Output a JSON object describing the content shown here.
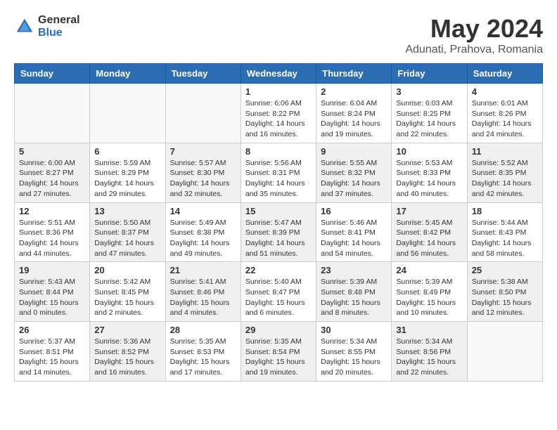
{
  "logo": {
    "general": "General",
    "blue": "Blue"
  },
  "title": {
    "month_year": "May 2024",
    "location": "Adunati, Prahova, Romania"
  },
  "weekdays": [
    "Sunday",
    "Monday",
    "Tuesday",
    "Wednesday",
    "Thursday",
    "Friday",
    "Saturday"
  ],
  "weeks": [
    [
      {
        "day": "",
        "info": "",
        "empty": true
      },
      {
        "day": "",
        "info": "",
        "empty": true
      },
      {
        "day": "",
        "info": "",
        "empty": true
      },
      {
        "day": "1",
        "info": "Sunrise: 6:06 AM\nSunset: 8:22 PM\nDaylight: 14 hours\nand 16 minutes."
      },
      {
        "day": "2",
        "info": "Sunrise: 6:04 AM\nSunset: 8:24 PM\nDaylight: 14 hours\nand 19 minutes."
      },
      {
        "day": "3",
        "info": "Sunrise: 6:03 AM\nSunset: 8:25 PM\nDaylight: 14 hours\nand 22 minutes."
      },
      {
        "day": "4",
        "info": "Sunrise: 6:01 AM\nSunset: 8:26 PM\nDaylight: 14 hours\nand 24 minutes."
      }
    ],
    [
      {
        "day": "5",
        "info": "Sunrise: 6:00 AM\nSunset: 8:27 PM\nDaylight: 14 hours\nand 27 minutes.",
        "shaded": true
      },
      {
        "day": "6",
        "info": "Sunrise: 5:59 AM\nSunset: 8:29 PM\nDaylight: 14 hours\nand 29 minutes."
      },
      {
        "day": "7",
        "info": "Sunrise: 5:57 AM\nSunset: 8:30 PM\nDaylight: 14 hours\nand 32 minutes.",
        "shaded": true
      },
      {
        "day": "8",
        "info": "Sunrise: 5:56 AM\nSunset: 8:31 PM\nDaylight: 14 hours\nand 35 minutes."
      },
      {
        "day": "9",
        "info": "Sunrise: 5:55 AM\nSunset: 8:32 PM\nDaylight: 14 hours\nand 37 minutes.",
        "shaded": true
      },
      {
        "day": "10",
        "info": "Sunrise: 5:53 AM\nSunset: 8:33 PM\nDaylight: 14 hours\nand 40 minutes."
      },
      {
        "day": "11",
        "info": "Sunrise: 5:52 AM\nSunset: 8:35 PM\nDaylight: 14 hours\nand 42 minutes.",
        "shaded": true
      }
    ],
    [
      {
        "day": "12",
        "info": "Sunrise: 5:51 AM\nSunset: 8:36 PM\nDaylight: 14 hours\nand 44 minutes."
      },
      {
        "day": "13",
        "info": "Sunrise: 5:50 AM\nSunset: 8:37 PM\nDaylight: 14 hours\nand 47 minutes.",
        "shaded": true
      },
      {
        "day": "14",
        "info": "Sunrise: 5:49 AM\nSunset: 8:38 PM\nDaylight: 14 hours\nand 49 minutes."
      },
      {
        "day": "15",
        "info": "Sunrise: 5:47 AM\nSunset: 8:39 PM\nDaylight: 14 hours\nand 51 minutes.",
        "shaded": true
      },
      {
        "day": "16",
        "info": "Sunrise: 5:46 AM\nSunset: 8:41 PM\nDaylight: 14 hours\nand 54 minutes."
      },
      {
        "day": "17",
        "info": "Sunrise: 5:45 AM\nSunset: 8:42 PM\nDaylight: 14 hours\nand 56 minutes.",
        "shaded": true
      },
      {
        "day": "18",
        "info": "Sunrise: 5:44 AM\nSunset: 8:43 PM\nDaylight: 14 hours\nand 58 minutes."
      }
    ],
    [
      {
        "day": "19",
        "info": "Sunrise: 5:43 AM\nSunset: 8:44 PM\nDaylight: 15 hours\nand 0 minutes.",
        "shaded": true
      },
      {
        "day": "20",
        "info": "Sunrise: 5:42 AM\nSunset: 8:45 PM\nDaylight: 15 hours\nand 2 minutes."
      },
      {
        "day": "21",
        "info": "Sunrise: 5:41 AM\nSunset: 8:46 PM\nDaylight: 15 hours\nand 4 minutes.",
        "shaded": true
      },
      {
        "day": "22",
        "info": "Sunrise: 5:40 AM\nSunset: 8:47 PM\nDaylight: 15 hours\nand 6 minutes."
      },
      {
        "day": "23",
        "info": "Sunrise: 5:39 AM\nSunset: 8:48 PM\nDaylight: 15 hours\nand 8 minutes.",
        "shaded": true
      },
      {
        "day": "24",
        "info": "Sunrise: 5:39 AM\nSunset: 8:49 PM\nDaylight: 15 hours\nand 10 minutes."
      },
      {
        "day": "25",
        "info": "Sunrise: 5:38 AM\nSunset: 8:50 PM\nDaylight: 15 hours\nand 12 minutes.",
        "shaded": true
      }
    ],
    [
      {
        "day": "26",
        "info": "Sunrise: 5:37 AM\nSunset: 8:51 PM\nDaylight: 15 hours\nand 14 minutes."
      },
      {
        "day": "27",
        "info": "Sunrise: 5:36 AM\nSunset: 8:52 PM\nDaylight: 15 hours\nand 16 minutes.",
        "shaded": true
      },
      {
        "day": "28",
        "info": "Sunrise: 5:35 AM\nSunset: 8:53 PM\nDaylight: 15 hours\nand 17 minutes."
      },
      {
        "day": "29",
        "info": "Sunrise: 5:35 AM\nSunset: 8:54 PM\nDaylight: 15 hours\nand 19 minutes.",
        "shaded": true
      },
      {
        "day": "30",
        "info": "Sunrise: 5:34 AM\nSunset: 8:55 PM\nDaylight: 15 hours\nand 20 minutes."
      },
      {
        "day": "31",
        "info": "Sunrise: 5:34 AM\nSunset: 8:56 PM\nDaylight: 15 hours\nand 22 minutes.",
        "shaded": true
      },
      {
        "day": "",
        "info": "",
        "empty": true
      }
    ]
  ]
}
